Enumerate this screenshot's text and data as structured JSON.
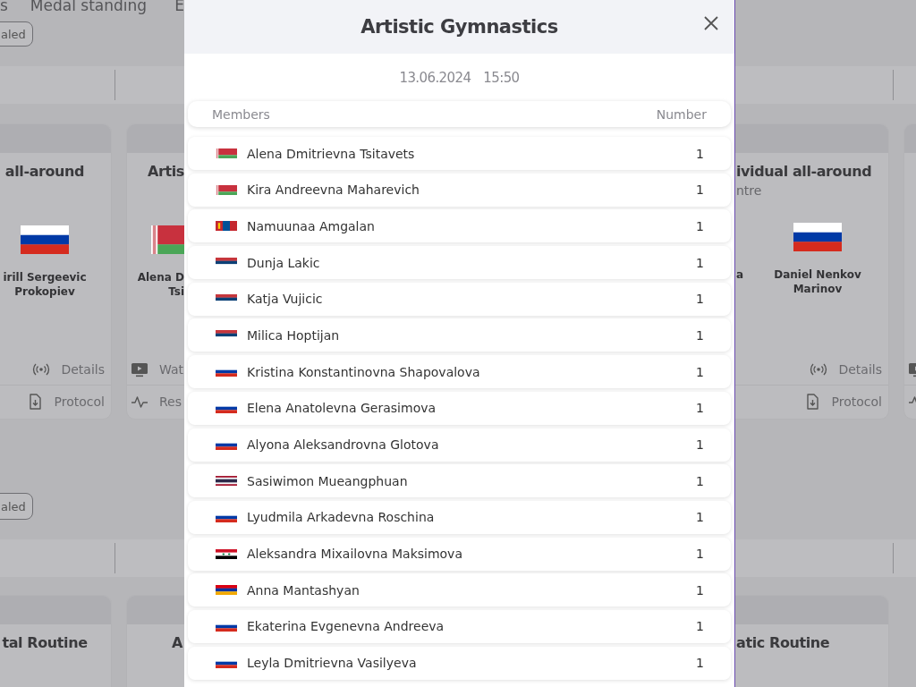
{
  "page": {
    "nav": [
      "s",
      "Medal standing",
      "E"
    ],
    "sections": [
      {
        "filter_button": "aled",
        "cards": [
          {
            "title": "all-around",
            "athletes": [
              {
                "kind": "ru",
                "name": "irill Sergeevic\nProkopiev"
              }
            ],
            "right_actions": [
              {
                "kind": "link",
                "label": "Details"
              },
              {
                "kind": "link",
                "label": "Protocol"
              }
            ]
          },
          {
            "title": "Artis",
            "athletes": [
              {
                "kind": "by",
                "name": "Alena D\nTsi"
              }
            ],
            "left_actions": [
              {
                "kind": "link",
                "label": "Wat"
              },
              {
                "kind": "link",
                "label": "Res"
              }
            ]
          },
          {
            "title": "ividual all-around",
            "subtitle": "ntre",
            "athletes": [
              {
                "kind": "none",
                "name": "a"
              },
              {
                "kind": "ru",
                "name": "Daniel Nenkov\nMarinov"
              }
            ],
            "right_actions": [
              {
                "kind": "link",
                "label": "Details"
              },
              {
                "kind": "link",
                "label": "Protocol"
              }
            ]
          },
          {
            "left_actions": [
              {
                "kind": "icon"
              },
              {
                "kind": "icon"
              }
            ]
          }
        ]
      },
      {
        "filter_button": "aled",
        "cards": [
          {
            "title": "tal Routine"
          },
          {
            "title": "A"
          },
          {
            "title": "atic Routine"
          }
        ]
      }
    ]
  },
  "modal": {
    "title": "Artistic Gymnastics",
    "date": "13.06.2024",
    "time": "15:50",
    "columns": [
      "Members",
      "Number"
    ],
    "members": [
      {
        "kind": "by",
        "name": "Alena Dmitrievna Tsitavets",
        "number": "1"
      },
      {
        "kind": "by",
        "name": "Kira Andreevna Maharevich",
        "number": "1"
      },
      {
        "kind": "mn",
        "name": "Namuunaa Amgalan",
        "number": "1"
      },
      {
        "kind": "rs",
        "name": "Dunja Lakic",
        "number": "1"
      },
      {
        "kind": "rs",
        "name": "Katja Vujicic",
        "number": "1"
      },
      {
        "kind": "rs",
        "name": "Milica Hoptijan",
        "number": "1"
      },
      {
        "kind": "ru",
        "name": "Kristina Konstantinovna Shapovalova",
        "number": "1"
      },
      {
        "kind": "ru",
        "name": "Elena Anatolevna Gerasimova",
        "number": "1"
      },
      {
        "kind": "ru",
        "name": "Alyona Aleksandrovna Glotova",
        "number": "1"
      },
      {
        "kind": "th",
        "name": "Sasiwimon Mueangphuan",
        "number": "1"
      },
      {
        "kind": "ru",
        "name": "Lyudmila Arkadevna Roschina",
        "number": "1"
      },
      {
        "kind": "sy",
        "name": "Aleksandra Mixailovna Maksimova",
        "number": "1"
      },
      {
        "kind": "am",
        "name": "Anna Mantashyan",
        "number": "1"
      },
      {
        "kind": "ru",
        "name": "Ekaterina Evgenevna Andreeva",
        "number": "1"
      },
      {
        "kind": "ru",
        "name": "Leyla Dmitrievna Vasilyeva",
        "number": "1"
      }
    ]
  }
}
